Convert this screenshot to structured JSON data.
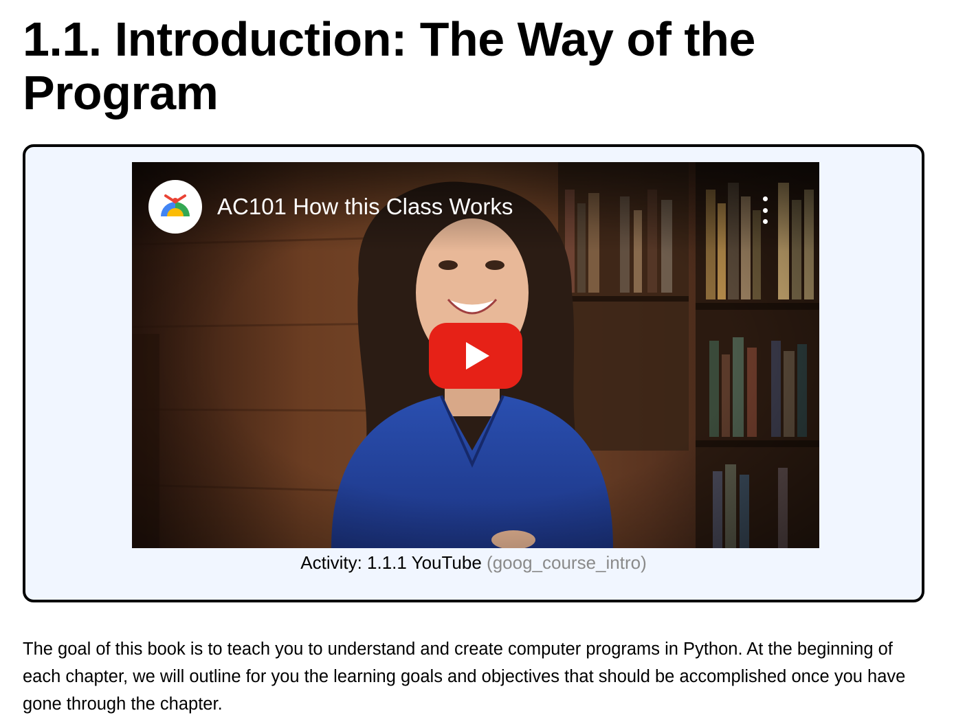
{
  "page": {
    "title": "1.1. Introduction: The Way of the Program"
  },
  "video": {
    "title": "AC101 How this Class Works",
    "channel_icon": "google-logo-icon",
    "menu_icon": "more-vertical-icon",
    "play_icon": "youtube-play-icon",
    "play_color": "#e62117"
  },
  "activity": {
    "label": "Activity: 1.1.1 YouTube",
    "id": "(goog_course_intro)"
  },
  "intro": {
    "text": "The goal of this book is to teach you to understand and create computer programs in Python. At the beginning of each chapter, we will outline for you the learning goals and objectives that should be accomplished once you have gone through the chapter."
  },
  "colors": {
    "box_background": "#f1f6ff",
    "box_border": "#000000",
    "activity_id": "#8a8a8a"
  }
}
